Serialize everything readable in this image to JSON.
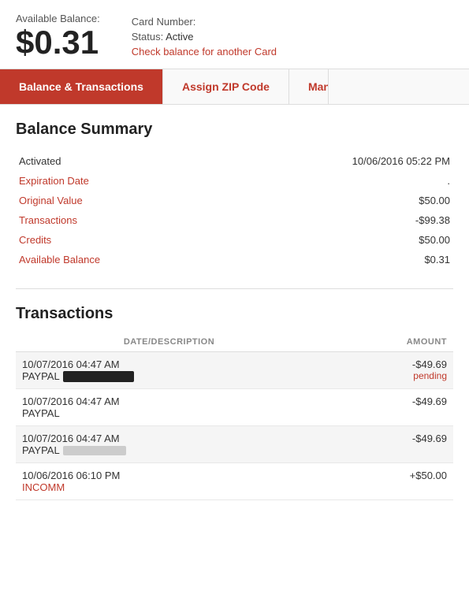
{
  "header": {
    "available_balance_label": "Available Balance:",
    "balance_amount": "$0.31",
    "card_number_label": "Card Number:",
    "status_label": "Status:",
    "status_value": "Active",
    "check_balance_link": "Check balance for another Card"
  },
  "tabs": [
    {
      "label": "Balance & Transactions",
      "active": true
    },
    {
      "label": "Assign ZIP Code",
      "active": false
    },
    {
      "label": "Man",
      "active": false,
      "cut": true
    }
  ],
  "balance_summary": {
    "title": "Balance Summary",
    "rows": [
      {
        "label": "Activated",
        "value": "10/06/2016 05:22 PM",
        "label_dark": true
      },
      {
        "label": "Expiration Date",
        "value": ".",
        "link": true
      },
      {
        "label": "Original Value",
        "value": "$50.00",
        "link": true
      },
      {
        "label": "Transactions",
        "value": "-$99.38",
        "link": true
      },
      {
        "label": "Credits",
        "value": "$50.00",
        "link": true
      },
      {
        "label": "Available Balance",
        "value": "$0.31",
        "link": true
      }
    ]
  },
  "transactions": {
    "title": "Transactions",
    "columns": {
      "description": "DATE/DESCRIPTION",
      "amount": "AMOUNT"
    },
    "rows": [
      {
        "datetime": "10/07/2016 04:47 AM",
        "merchant": "PAYPAL",
        "merchant_redacted": true,
        "amount": "-$49.69",
        "pending": "pending",
        "shaded": true
      },
      {
        "datetime": "10/07/2016 04:47 AM",
        "merchant": "PAYPAL",
        "merchant_redacted": false,
        "amount": "-$49.69",
        "pending": "",
        "shaded": false
      },
      {
        "datetime": "10/07/2016 04:47 AM",
        "merchant": "PAYPAL",
        "merchant_redacted": "light",
        "amount": "-$49.69",
        "pending": "",
        "shaded": true
      },
      {
        "datetime": "10/06/2016 06:10 PM",
        "merchant": "INCOMM",
        "merchant_redacted": false,
        "amount": "+$50.00",
        "pending": "",
        "shaded": false
      }
    ]
  }
}
